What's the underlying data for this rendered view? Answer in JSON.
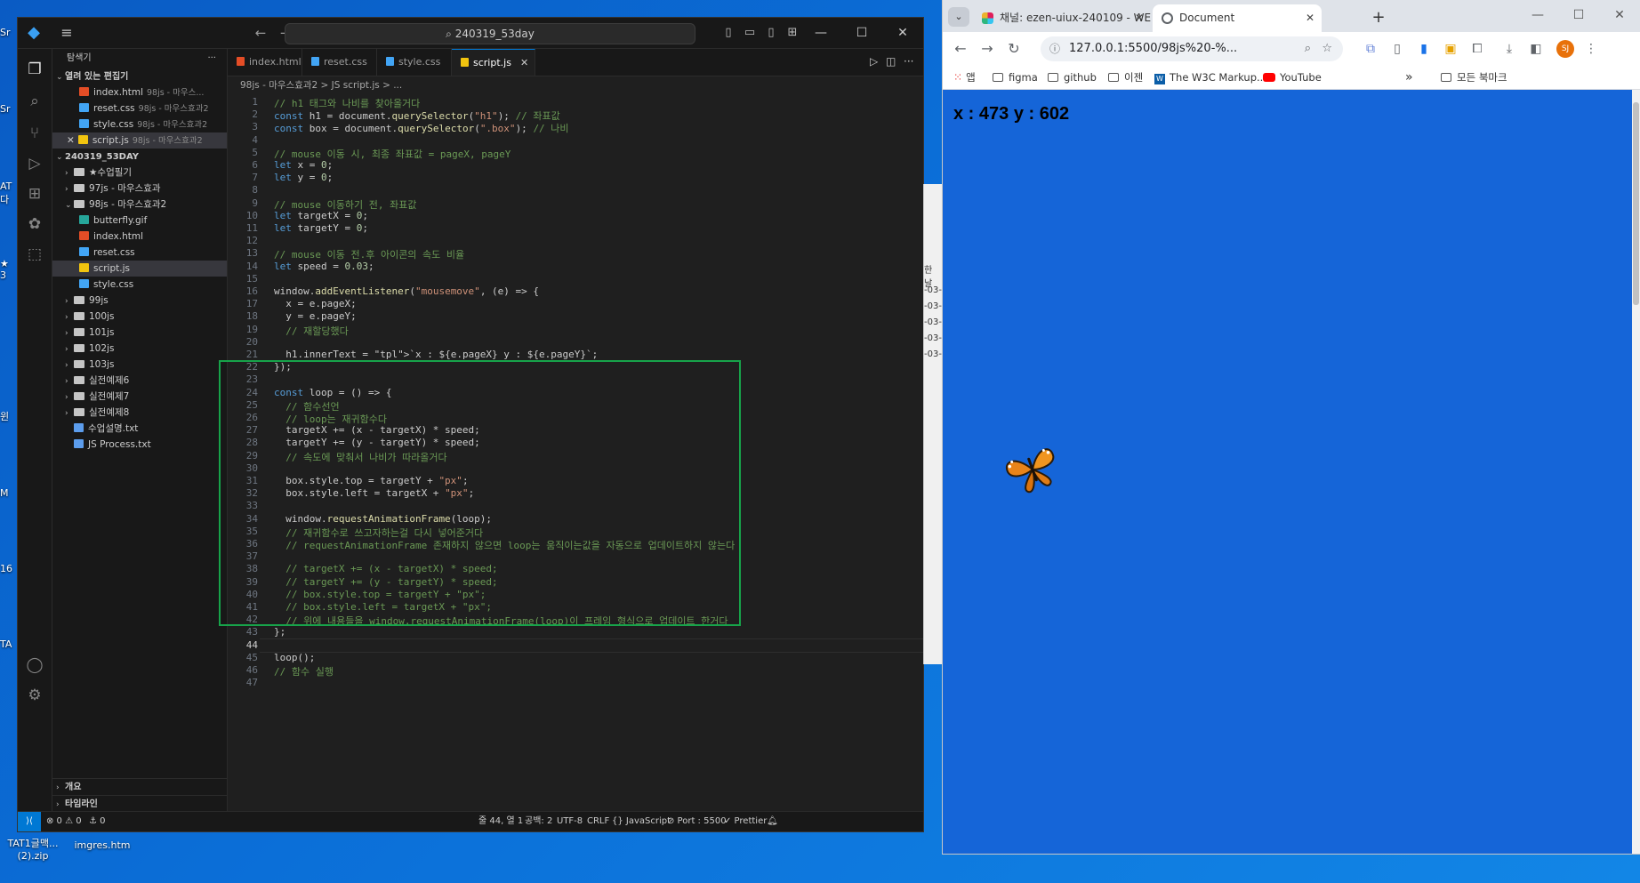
{
  "desktop": {
    "icons": [
      {
        "label": "TAT1글맥...\n(2).zip"
      },
      {
        "label": "imgres.htm"
      }
    ],
    "edge_labels": [
      "Sr",
      "Sr",
      "AT",
      "다",
      "★",
      "3",
      "윈",
      "M",
      "16",
      "TA"
    ]
  },
  "vscode": {
    "search_text": "240319_53day",
    "sidebar": {
      "title": "탐색기",
      "open_editors_title": "열려 있는 편집기",
      "open_editors": [
        {
          "name": "index.html",
          "desc": "98js - 마우스..."
        },
        {
          "name": "reset.css",
          "desc": "98js - 마우스효과2"
        },
        {
          "name": "style.css",
          "desc": "98js - 마우스효과2"
        },
        {
          "name": "script.js",
          "desc": "98js - 마우스효과2"
        }
      ],
      "workspace_title": "240319_53DAY",
      "tree": [
        {
          "name": "★수업필기",
          "type": "folder",
          "indent": 1
        },
        {
          "name": "97js - 마우스효과",
          "type": "folder",
          "indent": 1
        },
        {
          "name": "98js - 마우스효과2",
          "type": "folder-open",
          "indent": 1
        },
        {
          "name": "butterfly.gif",
          "type": "gif",
          "indent": 2
        },
        {
          "name": "index.html",
          "type": "html",
          "indent": 2
        },
        {
          "name": "reset.css",
          "type": "css",
          "indent": 2
        },
        {
          "name": "script.js",
          "type": "js",
          "indent": 2
        },
        {
          "name": "style.css",
          "type": "css",
          "indent": 2
        },
        {
          "name": "99js",
          "type": "folder",
          "indent": 1
        },
        {
          "name": "100js",
          "type": "folder",
          "indent": 1
        },
        {
          "name": "101js",
          "type": "folder",
          "indent": 1
        },
        {
          "name": "102js",
          "type": "folder",
          "indent": 1
        },
        {
          "name": "103js",
          "type": "folder",
          "indent": 1
        },
        {
          "name": "실전예제6",
          "type": "folder",
          "indent": 1
        },
        {
          "name": "실전예제7",
          "type": "folder",
          "indent": 1
        },
        {
          "name": "실전예제8",
          "type": "folder",
          "indent": 1
        },
        {
          "name": "수업설명.txt",
          "type": "txt",
          "indent": 1
        },
        {
          "name": "JS Process.txt",
          "type": "txt",
          "indent": 1
        }
      ],
      "outline": "개요",
      "timeline": "타임라인"
    },
    "tabs": [
      {
        "label": "index.html"
      },
      {
        "label": "reset.css"
      },
      {
        "label": "style.css"
      },
      {
        "label": "script.js"
      }
    ],
    "breadcrumb": "98js - 마우스효과2 > JS script.js > ...",
    "current_line": 44,
    "status": {
      "errors": "⊗ 0 ⚠ 0",
      "ports": "⚓ 0",
      "position": "줄 44, 열 1",
      "spaces": "공백: 2",
      "encoding": "UTF-8",
      "eol": "CRLF",
      "language": "{} JavaScript",
      "port": "⊘ Port : 5500",
      "prettier": "✓ Prettier"
    },
    "code": [
      {
        "n": 1,
        "t": "// h1 태그와 나비를 찾아올거다"
      },
      {
        "n": 2,
        "t": "const h1 = document.querySelector(\"h1\"); // 좌표값"
      },
      {
        "n": 3,
        "t": "const box = document.querySelector(\".box\"); // 나비"
      },
      {
        "n": 4,
        "t": ""
      },
      {
        "n": 5,
        "t": "// mouse 이동 시, 최종 좌표값 = pageX, pageY"
      },
      {
        "n": 6,
        "t": "let x = 0;"
      },
      {
        "n": 7,
        "t": "let y = 0;"
      },
      {
        "n": 8,
        "t": ""
      },
      {
        "n": 9,
        "t": "// mouse 이동하기 전, 좌표값"
      },
      {
        "n": 10,
        "t": "let targetX = 0;"
      },
      {
        "n": 11,
        "t": "let targetY = 0;"
      },
      {
        "n": 12,
        "t": ""
      },
      {
        "n": 13,
        "t": "// mouse 이동 전.후 아이콘의 속도 비율"
      },
      {
        "n": 14,
        "t": "let speed = 0.03;"
      },
      {
        "n": 15,
        "t": ""
      },
      {
        "n": 16,
        "t": "window.addEventListener(\"mousemove\", (e) => {"
      },
      {
        "n": 17,
        "t": "  x = e.pageX;"
      },
      {
        "n": 18,
        "t": "  y = e.pageY;"
      },
      {
        "n": 19,
        "t": "  // 재할당했다"
      },
      {
        "n": 20,
        "t": ""
      },
      {
        "n": 21,
        "t": "  h1.innerText = `x : ${e.pageX} y : ${e.pageY}`;"
      },
      {
        "n": 22,
        "t": "});"
      },
      {
        "n": 23,
        "t": ""
      },
      {
        "n": 24,
        "t": "const loop = () => {"
      },
      {
        "n": 25,
        "t": "  // 함수선언"
      },
      {
        "n": 26,
        "t": "  // loop는 재귀함수다"
      },
      {
        "n": 27,
        "t": "  targetX += (x - targetX) * speed;"
      },
      {
        "n": 28,
        "t": "  targetY += (y - targetY) * speed;"
      },
      {
        "n": 29,
        "t": "  // 속도에 맞춰서 나비가 따라올거다"
      },
      {
        "n": 30,
        "t": ""
      },
      {
        "n": 31,
        "t": "  box.style.top = targetY + \"px\";"
      },
      {
        "n": 32,
        "t": "  box.style.left = targetX + \"px\";"
      },
      {
        "n": 33,
        "t": ""
      },
      {
        "n": 34,
        "t": "  window.requestAnimationFrame(loop);"
      },
      {
        "n": 35,
        "t": "  // 재귀함수로 쓰고자하는걸 다시 넣어준거다"
      },
      {
        "n": 36,
        "t": "  // requestAnimationFrame 존재하지 않으면 loop는 움직이는값을 자동으로 업데이트하지 않는다"
      },
      {
        "n": 37,
        "t": ""
      },
      {
        "n": 38,
        "t": "  // targetX += (x - targetX) * speed;"
      },
      {
        "n": 39,
        "t": "  // targetY += (y - targetY) * speed;"
      },
      {
        "n": 40,
        "t": "  // box.style.top = targetY + \"px\";"
      },
      {
        "n": 41,
        "t": "  // box.style.left = targetX + \"px\";"
      },
      {
        "n": 42,
        "t": "  // 위에 내용들을 window.requestAnimationFrame(loop)이 프레임 형식으로 업데이트 한거다"
      },
      {
        "n": 43,
        "t": "};"
      },
      {
        "n": 44,
        "t": ""
      },
      {
        "n": 45,
        "t": "loop();"
      },
      {
        "n": 46,
        "t": "// 함수 실행"
      },
      {
        "n": 47,
        "t": ""
      }
    ]
  },
  "behind_window": {
    "fragments": [
      "한 날",
      "-03-",
      "-03-",
      "-03-",
      "-03-",
      "-03-"
    ]
  },
  "chrome": {
    "tabs": [
      {
        "label": "채널: ezen-uiux-240109 - WEB"
      },
      {
        "label": "Document"
      }
    ],
    "url": "127.0.0.1:5500/98js%20-%...",
    "bookmarks": [
      {
        "label": "앱"
      },
      {
        "label": "figma"
      },
      {
        "label": "github"
      },
      {
        "label": "이젠"
      },
      {
        "label": "The W3C Markup..."
      },
      {
        "label": "YouTube"
      }
    ],
    "all_bookmarks": "모든 북마크",
    "profile_initials": "SJ",
    "page_h1": "x : 473 y : 602",
    "page_bg": "#1565d8"
  }
}
